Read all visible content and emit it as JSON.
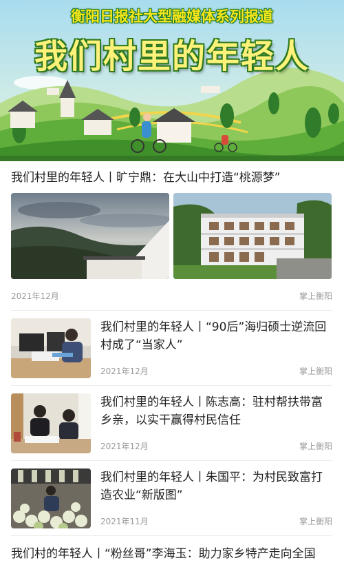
{
  "banner": {
    "kicker": "衡阳日报社大型融媒体系列报道",
    "headline": "我们村里的年轻人"
  },
  "featured": {
    "title": "我们村里的年轻人丨旷宁鼎：在大山中打造“桃源梦”",
    "date": "2021年12月",
    "source": "掌上衡阳"
  },
  "articles": [
    {
      "title": "我们村里的年轻人丨“90后”海归硕士逆流回村成了“当家人”",
      "date": "2021年12月",
      "source": "掌上衡阳"
    },
    {
      "title": "我们村里的年轻人丨陈志高：驻村帮扶带富乡亲，以实干赢得村民信任",
      "date": "2021年12月",
      "source": "掌上衡阳"
    },
    {
      "title": "我们村里的年轻人丨朱国平：为村民致富打造农业“新版图”",
      "date": "2021年11月",
      "source": "掌上衡阳"
    }
  ],
  "last": {
    "title": "我们村的年轻人丨“粉丝哥”李海玉：助力家乡特产走向全国"
  }
}
